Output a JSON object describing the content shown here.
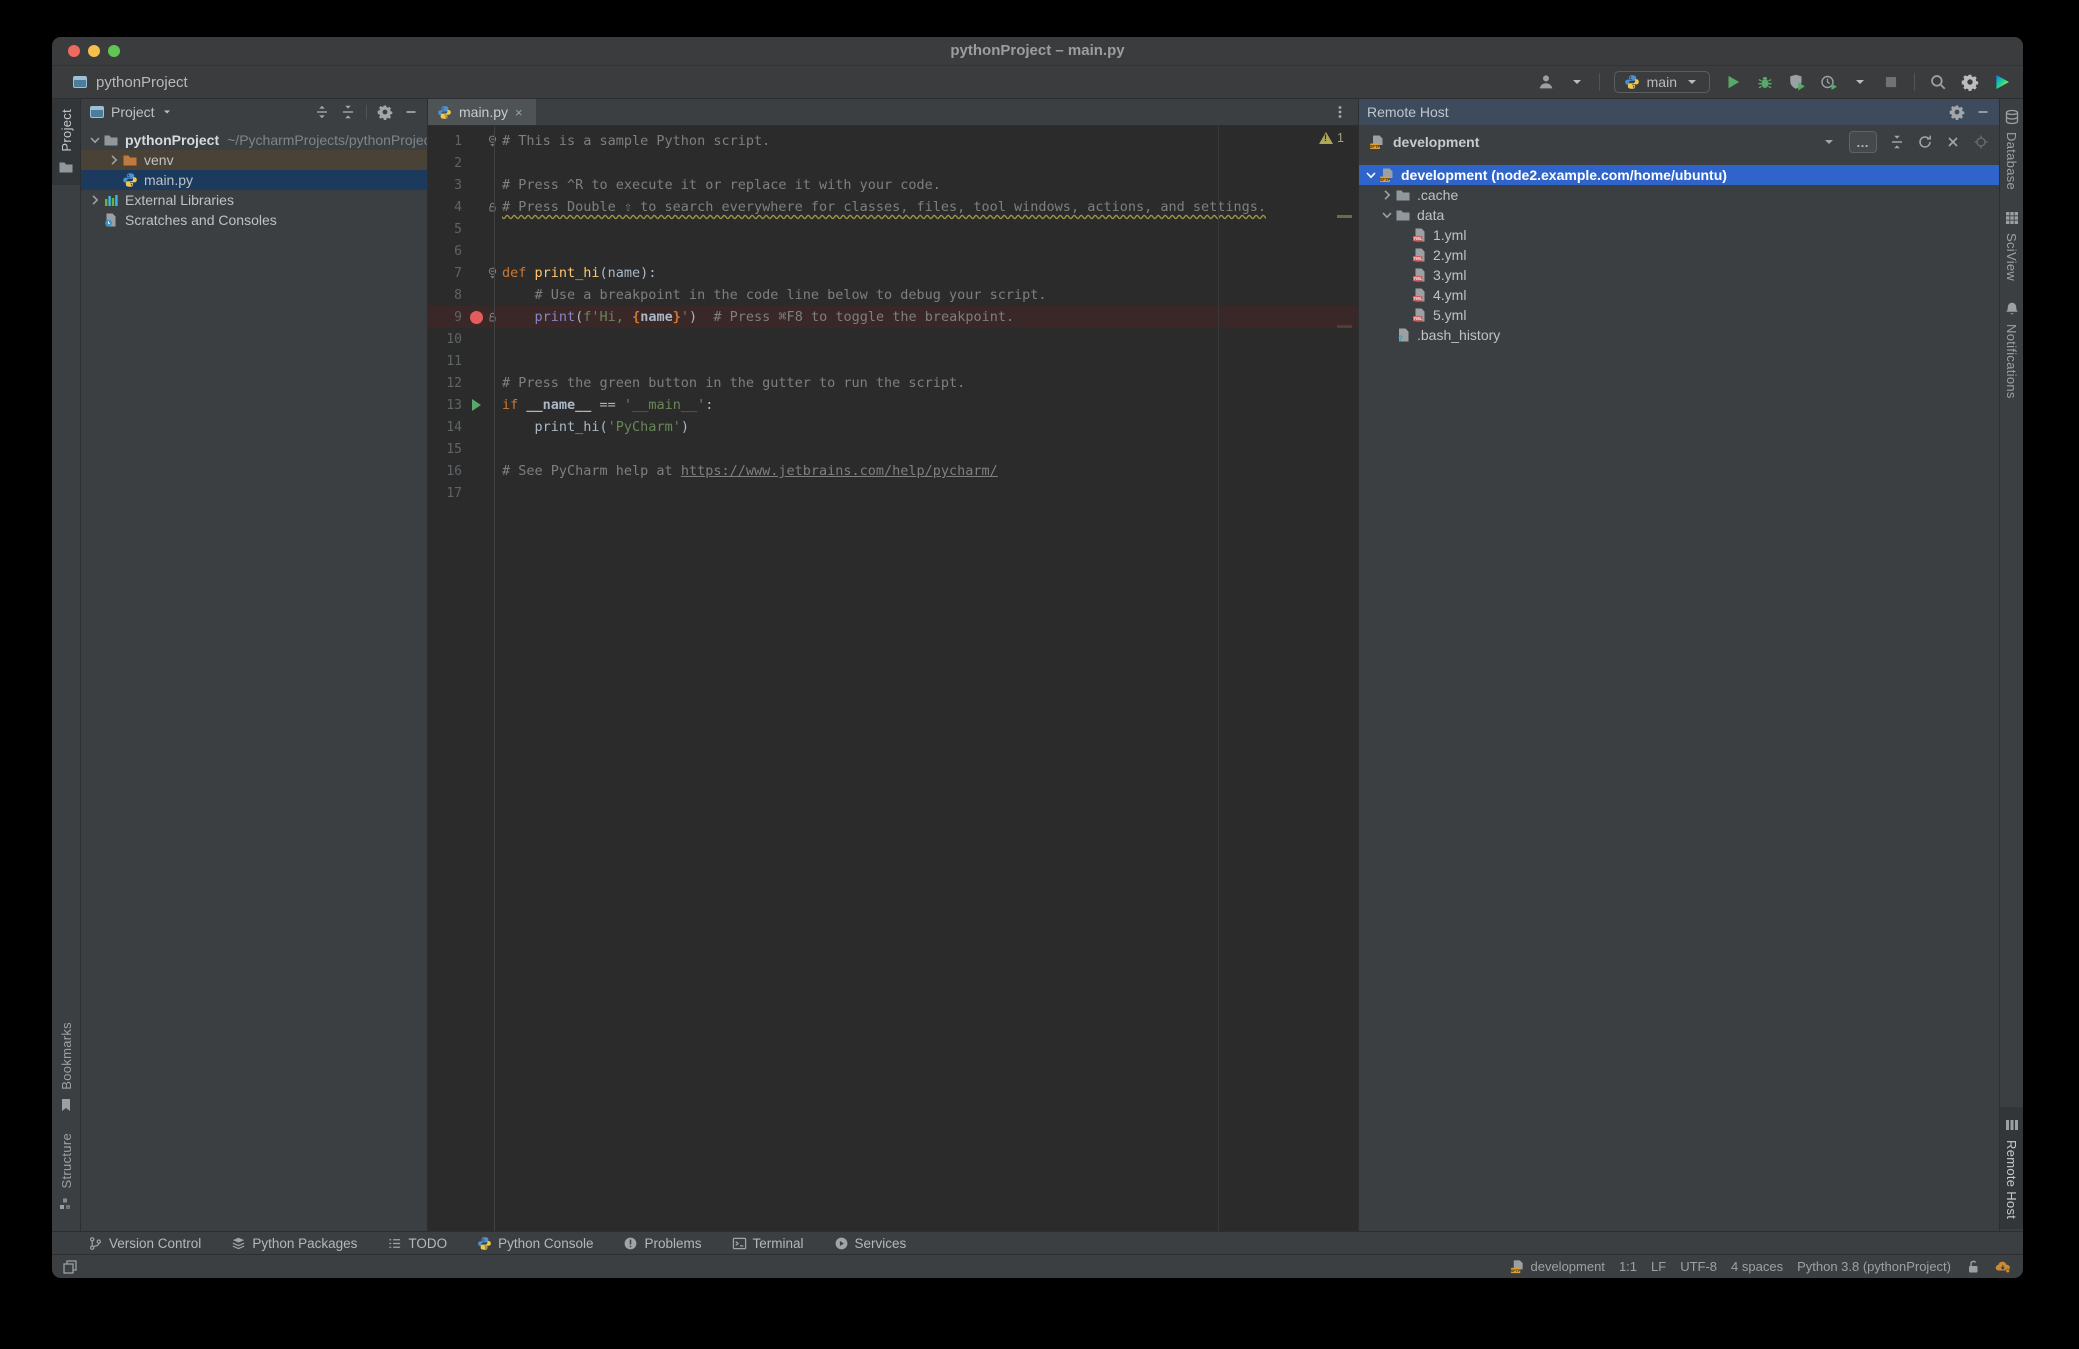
{
  "window": {
    "title": "pythonProject – main.py"
  },
  "toolbar": {
    "project": "pythonProject",
    "run_config": "main",
    "controls": [
      "user",
      "|",
      "pill",
      "run",
      "debug",
      "coverage",
      "profiler",
      "stop",
      "|",
      "search",
      "settings",
      "logo"
    ]
  },
  "left_strip": {
    "top": [
      {
        "label": "Project",
        "icon": "folder",
        "selected": true
      }
    ],
    "bottom": [
      {
        "label": "Bookmarks",
        "icon": "bookmark"
      },
      {
        "label": "Structure",
        "icon": "structure"
      }
    ]
  },
  "right_strip": {
    "top": [
      {
        "label": "Database",
        "icon": "database"
      },
      {
        "label": "SciView",
        "icon": "sciview"
      },
      {
        "label": "Notifications",
        "icon": "bell"
      }
    ],
    "bottom": [
      {
        "label": "Remote Host",
        "icon": "server",
        "selected": true
      }
    ]
  },
  "project_panel": {
    "title": "Project",
    "header_controls": [
      "expand-all",
      "collapse-all",
      "|",
      "settings",
      "hide"
    ],
    "tree": [
      {
        "label": "pythonProject",
        "secondary": "~/PycharmProjects/pythonProject",
        "icon": "folder",
        "chevron": "open",
        "depth": 0,
        "bold": true
      },
      {
        "label": "venv",
        "icon": "folder-excluded",
        "chevron": "closed",
        "depth": 1,
        "highlight": "excluded"
      },
      {
        "label": "main.py",
        "icon": "python",
        "depth": 1,
        "highlight": "selected"
      },
      {
        "label": "External Libraries",
        "icon": "libraries",
        "chevron": "closed",
        "depth": 0
      },
      {
        "label": "Scratches and Consoles",
        "icon": "scratches",
        "depth": 0
      }
    ]
  },
  "editor": {
    "tab": {
      "label": "main.py",
      "icon": "python"
    },
    "warning_count": "1",
    "lines": [
      {
        "n": "1",
        "fold": "fold",
        "tokens": [
          [
            "c",
            "# This is a sample Python script."
          ]
        ]
      },
      {
        "n": "2",
        "tokens": []
      },
      {
        "n": "3",
        "tokens": [
          [
            "c",
            "# Press ^R to execute it or replace it with your code."
          ]
        ]
      },
      {
        "n": "4",
        "fold": "mark",
        "tokens": [
          [
            "cw",
            "# Press Double ⇧ to search everywhere for classes, files, tool windows, actions, and settings."
          ]
        ]
      },
      {
        "n": "5",
        "tokens": []
      },
      {
        "n": "6",
        "tokens": []
      },
      {
        "n": "7",
        "fold": "fold",
        "tokens": [
          [
            "k",
            "def "
          ],
          [
            "fn",
            "print_hi"
          ],
          [
            "p",
            "(name):"
          ]
        ]
      },
      {
        "n": "8",
        "tokens": [
          [
            "c",
            "    # Use a breakpoint in the code line below to debug your script."
          ]
        ]
      },
      {
        "n": "9",
        "fold": "mark",
        "gutter": "breakpoint",
        "highlight": true,
        "tokens": [
          [
            "p",
            "    "
          ],
          [
            "b",
            "print"
          ],
          [
            "p",
            "("
          ],
          [
            "s",
            "f'Hi, "
          ],
          [
            "br",
            "{"
          ],
          [
            "v",
            "name"
          ],
          [
            "br",
            "}"
          ],
          [
            "s",
            "'"
          ],
          [
            "p",
            ")"
          ],
          [
            "c",
            "  # Press ⌘F8 to toggle the breakpoint."
          ]
        ]
      },
      {
        "n": "10",
        "tokens": []
      },
      {
        "n": "11",
        "tokens": []
      },
      {
        "n": "12",
        "tokens": [
          [
            "c",
            "# Press the green button in the gutter to run the script."
          ]
        ]
      },
      {
        "n": "13",
        "gutter": "run",
        "tokens": [
          [
            "k",
            "if "
          ],
          [
            "v",
            "__name__"
          ],
          [
            "p",
            " == "
          ],
          [
            "s",
            "'__main__'"
          ],
          [
            "p",
            ":"
          ]
        ]
      },
      {
        "n": "14",
        "tokens": [
          [
            "p",
            "    print_hi("
          ],
          [
            "s",
            "'PyCharm'"
          ],
          [
            "p",
            ")"
          ]
        ]
      },
      {
        "n": "15",
        "tokens": []
      },
      {
        "n": "16",
        "tokens": [
          [
            "c",
            "# See PyCharm help at "
          ],
          [
            "cl",
            "https://www.jetbrains.com/help/pycharm/"
          ]
        ]
      },
      {
        "n": "17",
        "tokens": []
      }
    ]
  },
  "remote_host": {
    "title": "Remote Host",
    "server": "development",
    "header_controls": [
      "settings",
      "hide"
    ],
    "toolbar_controls": [
      "dropdown",
      "more",
      "collapse-all",
      "sync",
      "close",
      "target"
    ],
    "tree": [
      {
        "label": "development (node2.example.com/home/ubuntu)",
        "icon": "sftp",
        "chevron": "open",
        "depth": 0,
        "selected": true
      },
      {
        "label": ".cache",
        "icon": "folder",
        "chevron": "closed",
        "depth": 1
      },
      {
        "label": "data",
        "icon": "folder",
        "chevron": "open",
        "depth": 1
      },
      {
        "label": "1.yml",
        "icon": "yml",
        "depth": 2
      },
      {
        "label": "2.yml",
        "icon": "yml",
        "depth": 2
      },
      {
        "label": "3.yml",
        "icon": "yml",
        "depth": 2
      },
      {
        "label": "4.yml",
        "icon": "yml",
        "depth": 2
      },
      {
        "label": "5.yml",
        "icon": "yml",
        "depth": 2
      },
      {
        "label": ".bash_history",
        "icon": "file-unknown",
        "depth": 1
      }
    ]
  },
  "bottom_bar": {
    "items": [
      {
        "label": "Version Control",
        "icon": "branch"
      },
      {
        "label": "Python Packages",
        "icon": "packages"
      },
      {
        "label": "TODO",
        "icon": "todo"
      },
      {
        "label": "Python Console",
        "icon": "python"
      },
      {
        "label": "Problems",
        "icon": "problems"
      },
      {
        "label": "Terminal",
        "icon": "terminal"
      },
      {
        "label": "Services",
        "icon": "services"
      }
    ]
  },
  "status_bar": {
    "host": "development",
    "items": [
      "1:1",
      "LF",
      "UTF-8",
      "4 spaces",
      "Python 3.8 (pythonProject)"
    ],
    "right_icons": [
      "lock-open",
      "cloud-sync"
    ]
  },
  "colors": {
    "selection_blue": "#2f65ca",
    "breakpoint_red": "#e35d5d",
    "run_green": "#59a869",
    "warning_olive": "#ada758",
    "excluded_brown": "#4b4237",
    "editor_bg": "#2b2b2b",
    "panel_bg": "#3c3f41"
  }
}
